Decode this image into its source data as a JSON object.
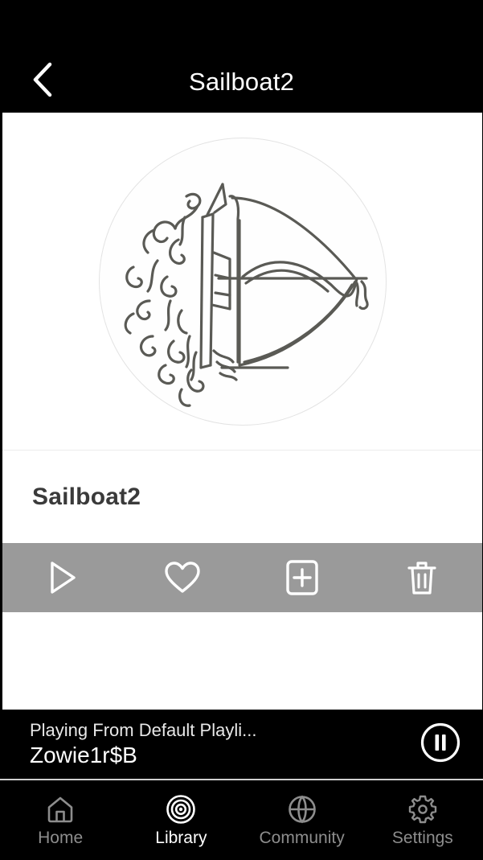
{
  "header": {
    "title": "Sailboat2",
    "back_icon": "chevron-left-icon"
  },
  "artwork": {
    "alt_name": "sailboat-line-art",
    "shape": "circle",
    "stroke_color": "#5a5a55",
    "ring_color": "#e3e3e3",
    "background": "#fefefe"
  },
  "detail": {
    "title": "Sailboat2"
  },
  "actions": {
    "bar_color": "#9a9a9a",
    "icon_color": "#ffffff",
    "items": [
      {
        "name": "play-button",
        "icon": "play-icon",
        "label": "Play"
      },
      {
        "name": "favorite-button",
        "icon": "heart-icon",
        "label": "Favorite"
      },
      {
        "name": "add-to-playlist-button",
        "icon": "plus-square-icon",
        "label": "Add to playlist"
      },
      {
        "name": "delete-button",
        "icon": "trash-icon",
        "label": "Delete"
      }
    ]
  },
  "mini_player": {
    "source": "Playing From Default Playli...",
    "track": "Zowie1r$B",
    "toggle_icon": "pause-circle-icon",
    "toggle_label": "Pause"
  },
  "bottom_nav": {
    "active_color": "#ffffff",
    "inactive_color": "#8d8d8d",
    "items": [
      {
        "label": "Home",
        "icon": "home-icon",
        "active": false
      },
      {
        "label": "Library",
        "icon": "target-icon",
        "active": true
      },
      {
        "label": "Community",
        "icon": "globe-icon",
        "active": false
      },
      {
        "label": "Settings",
        "icon": "gear-icon",
        "active": false
      }
    ]
  }
}
